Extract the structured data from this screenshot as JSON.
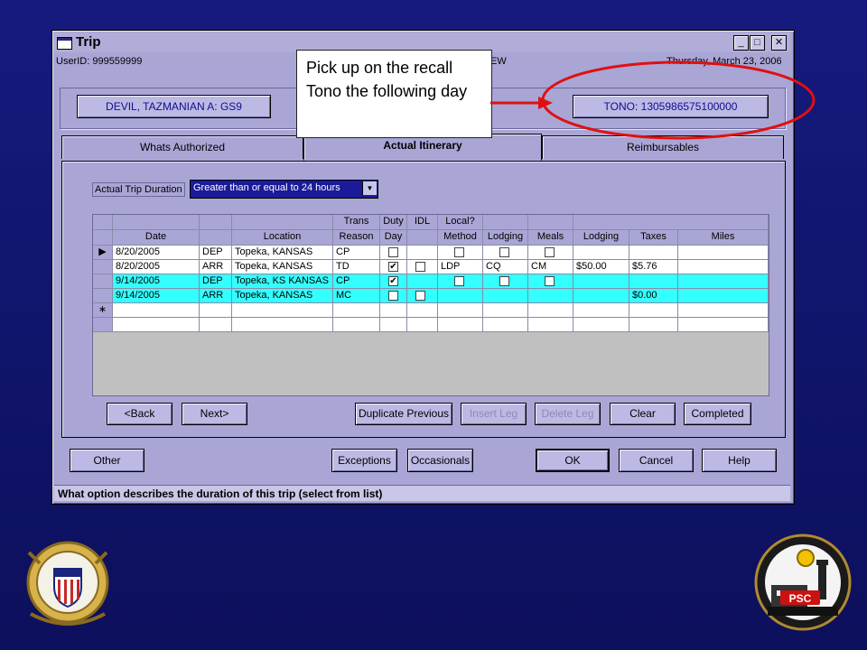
{
  "window": {
    "title": "Trip",
    "minimize": "_",
    "maximize": "□",
    "close": "✕"
  },
  "header": {
    "userid": "UserID: 999559999",
    "date": "Thursday, March 23, 2006",
    "mode_partial": "EW"
  },
  "name_button": "DEVIL, TAZMANIAN A: GS9",
  "tono_button": "TONO: 1305986575100000",
  "callout": {
    "text": "Pick up on the recall Tono the following day"
  },
  "tabs": [
    {
      "label": "Whats Authorized"
    },
    {
      "label": "Actual Itinerary"
    },
    {
      "label": "Reimbursables"
    }
  ],
  "duration": {
    "label": "Actual Trip Duration",
    "value": "Greater than or equal to 24 hours"
  },
  "table": {
    "group_headers": {
      "trans": "Trans",
      "duty": "Duty",
      "idl": "IDL",
      "local": "Local?"
    },
    "headers": [
      "Date",
      "",
      "Location",
      "Reason",
      "Day",
      "",
      "Method",
      "Lodging",
      "Meals",
      "Lodging",
      "Taxes",
      "Miles"
    ],
    "rows": [
      {
        "date": "8/20/2005",
        "code": "DEP",
        "location": "Topeka, KANSAS",
        "reason": "CP",
        "method": "",
        "lodging": "",
        "meals": "",
        "lodging_amt": "",
        "taxes": "",
        "miles": ""
      },
      {
        "date": "8/20/2005",
        "code": "ARR",
        "location": "Topeka, KANSAS",
        "reason": "TD",
        "method": "LDP",
        "lodging": "CQ",
        "meals": "CM",
        "lodging_amt": "$50.00",
        "taxes": "$5.76",
        "miles": ""
      },
      {
        "date": "9/14/2005",
        "code": "DEP",
        "location": "Topeka, KS KANSAS",
        "reason": "CP",
        "method": "",
        "lodging": "",
        "meals": "",
        "lodging_amt": "",
        "taxes": "",
        "miles": ""
      },
      {
        "date": "9/14/2005",
        "code": "ARR",
        "location": "Topeka, KANSAS",
        "reason": "MC",
        "method": "",
        "lodging": "",
        "meals": "",
        "lodging_amt": "",
        "taxes": "$0.00",
        "miles": ""
      }
    ],
    "current_row_marker": "▶",
    "new_row_marker": "∗"
  },
  "nav_buttons": {
    "back": "<Back",
    "next": "Next>",
    "duplicate": "Duplicate Previous",
    "insert": "Insert Leg",
    "delete": "Delete Leg",
    "clear": "Clear",
    "completed": "Completed"
  },
  "bottom_buttons": {
    "other": "Other",
    "exceptions": "Exceptions",
    "occasionals": "Occasionals",
    "ok": "OK",
    "cancel": "Cancel",
    "help": "Help"
  },
  "status_text": "What option describes the duration of this trip (select from list)",
  "colors": {
    "window_bg": "#a9a6d6",
    "highlight_row": "#33ffff",
    "annotation_red": "#e01010",
    "slide_bg": "#14187a"
  },
  "logos": {
    "left_seal_text": "UNITED STATES COAST GUARD 1790",
    "right_seal_text": "PSC Personnel Service Center TOPEKA"
  }
}
